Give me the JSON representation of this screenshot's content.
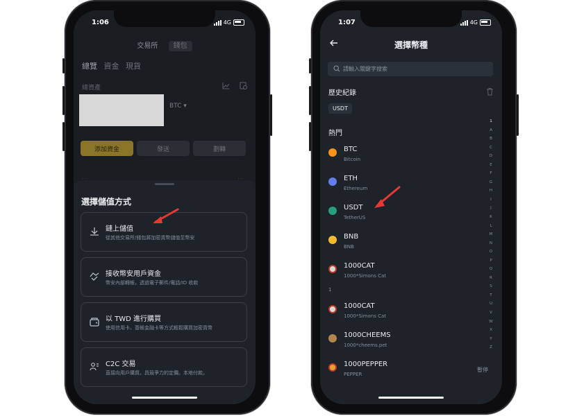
{
  "left_phone": {
    "status": {
      "time": "1:06",
      "network": "4G"
    },
    "top_segments": [
      "交易所",
      "錢包"
    ],
    "tabs": [
      "總覽",
      "資金",
      "現貨"
    ],
    "asset_label": "總資產",
    "asset_currency": "BTC ▾",
    "action_buttons": [
      "添加資金",
      "發送",
      "劃轉"
    ],
    "faint_row_left": "...",
    "faint_row_right": "...",
    "sheet": {
      "title": "選擇儲值方式",
      "options": [
        {
          "icon": "download-icon",
          "title": "鏈上儲值",
          "subtitle": "從其他交易所/錢包將加密貨幣儲值至幣安"
        },
        {
          "icon": "handshake-icon",
          "title": "接收幣安用戶資金",
          "subtitle": "幣安內部轉帳，透過電子郵件/電話/ID 收款"
        },
        {
          "icon": "wallet-icon",
          "title": "以 TWD 進行購買",
          "subtitle": "使用信用卡、簽帳金融卡等方式輕鬆購買加密貨幣"
        },
        {
          "icon": "users-icon",
          "title": "C2C 交易",
          "subtitle": "直接向用戶購買。具競爭力的定價。本地付款。"
        }
      ]
    }
  },
  "right_phone": {
    "status": {
      "time": "1:07",
      "network": "4G"
    },
    "title": "選擇幣種",
    "search_placeholder": "請輸入關鍵字搜索",
    "history_label": "歷史紀錄",
    "history_chip": "USDT",
    "hot_label": "熱門",
    "group_letter": "1",
    "coins": [
      {
        "symbol": "BTC",
        "name": "Bitcoin",
        "color": "#f7931a",
        "right": ""
      },
      {
        "symbol": "ETH",
        "name": "Ethereum",
        "color": "#627eea",
        "right": ""
      },
      {
        "symbol": "USDT",
        "name": "TetherUS",
        "color": "#26a17b",
        "right": ""
      },
      {
        "symbol": "BNB",
        "name": "BNB",
        "color": "#f3ba2f",
        "right": ""
      },
      {
        "symbol": "1000CAT",
        "name": "1000*Simons Cat",
        "color": "#d9d9d9",
        "right": ""
      },
      {
        "symbol": "1000CAT",
        "name": "1000*Simons Cat",
        "color": "#d9d9d9",
        "right": ""
      },
      {
        "symbol": "1000CHEEMS",
        "name": "1000*cheems.pet",
        "color": "#b0874f",
        "right": ""
      },
      {
        "symbol": "1000PEPPER",
        "name": "PEPPER",
        "color": "#e8a230",
        "right": "暫停"
      }
    ],
    "index_letters": [
      "1",
      "A",
      "B",
      "C",
      "D",
      "E",
      "F",
      "G",
      "H",
      "I",
      "J",
      "K",
      "L",
      "M",
      "N",
      "O",
      "P",
      "Q",
      "R",
      "S",
      "T",
      "U",
      "V",
      "W",
      "X",
      "Y",
      "Z"
    ]
  },
  "colors": {
    "accent": "#f0b90b",
    "arrow": "#e53935",
    "bg": "#1e2329"
  }
}
